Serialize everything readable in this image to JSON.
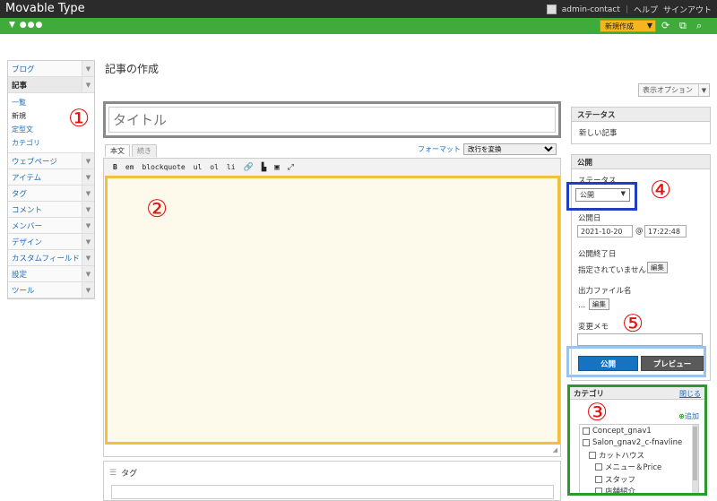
{
  "app": {
    "title": "Movable Type"
  },
  "topnav": {
    "user": "admin-contact",
    "help": "ヘルプ",
    "signout": "サインアウト"
  },
  "greenbar": {
    "menu": "▼ ●●●",
    "new_label": "新規作成"
  },
  "sidebar": {
    "items": [
      {
        "label": "ブログ"
      },
      {
        "label": "記事"
      },
      {
        "label": "ウェブページ"
      },
      {
        "label": "アイテム"
      },
      {
        "label": "タグ"
      },
      {
        "label": "コメント"
      },
      {
        "label": "メンバー"
      },
      {
        "label": "デザイン"
      },
      {
        "label": "カスタムフィールド"
      },
      {
        "label": "設定"
      },
      {
        "label": "ツール"
      }
    ],
    "subitems": [
      {
        "label": "一覧"
      },
      {
        "label": "新規"
      },
      {
        "label": "定型文"
      },
      {
        "label": "カテゴリ"
      }
    ]
  },
  "page": {
    "title": "記事の作成",
    "display_options": "表示オプション"
  },
  "editor": {
    "title_placeholder": "タイトル",
    "tab_body": "本文",
    "tab_more": "続き",
    "format_label": "フォーマット",
    "format_value": "改行を変換",
    "toolbar": [
      "B",
      "em",
      "blockquote",
      "ul",
      "ol",
      "li"
    ],
    "tags_label": "タグ"
  },
  "status_panel": {
    "heading": "ステータス",
    "value": "新しい記事"
  },
  "publish_panel": {
    "heading": "公開",
    "status_label": "ステータス",
    "status_value": "公開",
    "date_label": "公開日",
    "date": "2021-10-20",
    "at": "@",
    "time": "17:22:48",
    "end_label": "公開終了日",
    "end_value": "指定されていません",
    "edit": "編集",
    "file_label": "出力ファイル名",
    "file_value": "...",
    "memo_label": "変更メモ",
    "publish_btn": "公開",
    "preview_btn": "プレビュー"
  },
  "category_panel": {
    "heading": "カテゴリ",
    "close": "閉じる",
    "add": "追加",
    "items": [
      {
        "label": "Concept_gnav1"
      },
      {
        "label": "Salon_gnav2_c-fnavline"
      },
      {
        "label": "カットハウス"
      },
      {
        "label": "メニュー＆Price"
      },
      {
        "label": "スタッフ"
      },
      {
        "label": "店舗紹介"
      }
    ]
  },
  "annotations": [
    "①",
    "②",
    "③",
    "④",
    "⑤"
  ],
  "colors": {
    "accent_green": "#3eab3a",
    "new_button": "#f5b520",
    "publish_blue": "#1872c2",
    "box_yellow": "#f0c040",
    "box_blue": "#1f3fc0",
    "box_green": "#2a9a2a",
    "annotation_red": "#e81010"
  }
}
